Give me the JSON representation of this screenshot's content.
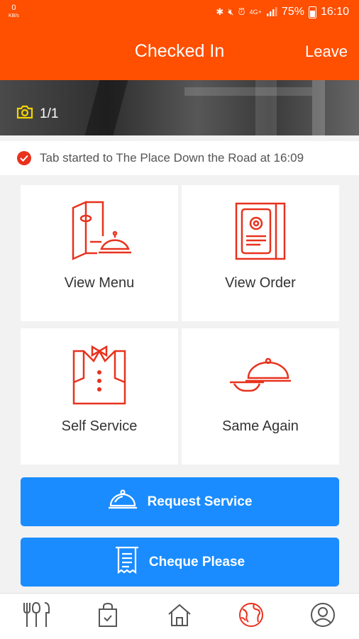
{
  "status_bar": {
    "net_speed": "0",
    "net_unit": "KB/s",
    "lte": "4G+",
    "battery_percent": "75%",
    "time": "16:10"
  },
  "header": {
    "title": "Checked In",
    "leave_label": "Leave"
  },
  "photo": {
    "counter": "1/1"
  },
  "notice": {
    "text": "Tab started to The Place Down the Road at 16:09"
  },
  "tiles": [
    {
      "label": "View Menu",
      "icon": "menu-cloche-icon"
    },
    {
      "label": "View Order",
      "icon": "order-ticket-icon"
    },
    {
      "label": "Self Service",
      "icon": "waiter-icon"
    },
    {
      "label": "Same Again",
      "icon": "cloche-plate-icon"
    }
  ],
  "buttons": {
    "request_service": "Request Service",
    "cheque_please": "Cheque Please"
  },
  "bottom_nav": [
    {
      "icon": "cutlery-icon"
    },
    {
      "icon": "shopping-bag-icon"
    },
    {
      "icon": "home-icon"
    },
    {
      "icon": "globe-icon",
      "active": true
    },
    {
      "icon": "profile-icon"
    }
  ],
  "colors": {
    "brand_orange": "#ff4f00",
    "icon_red": "#e8321e",
    "button_blue": "#1a8cff",
    "nav_gray": "#555555"
  }
}
